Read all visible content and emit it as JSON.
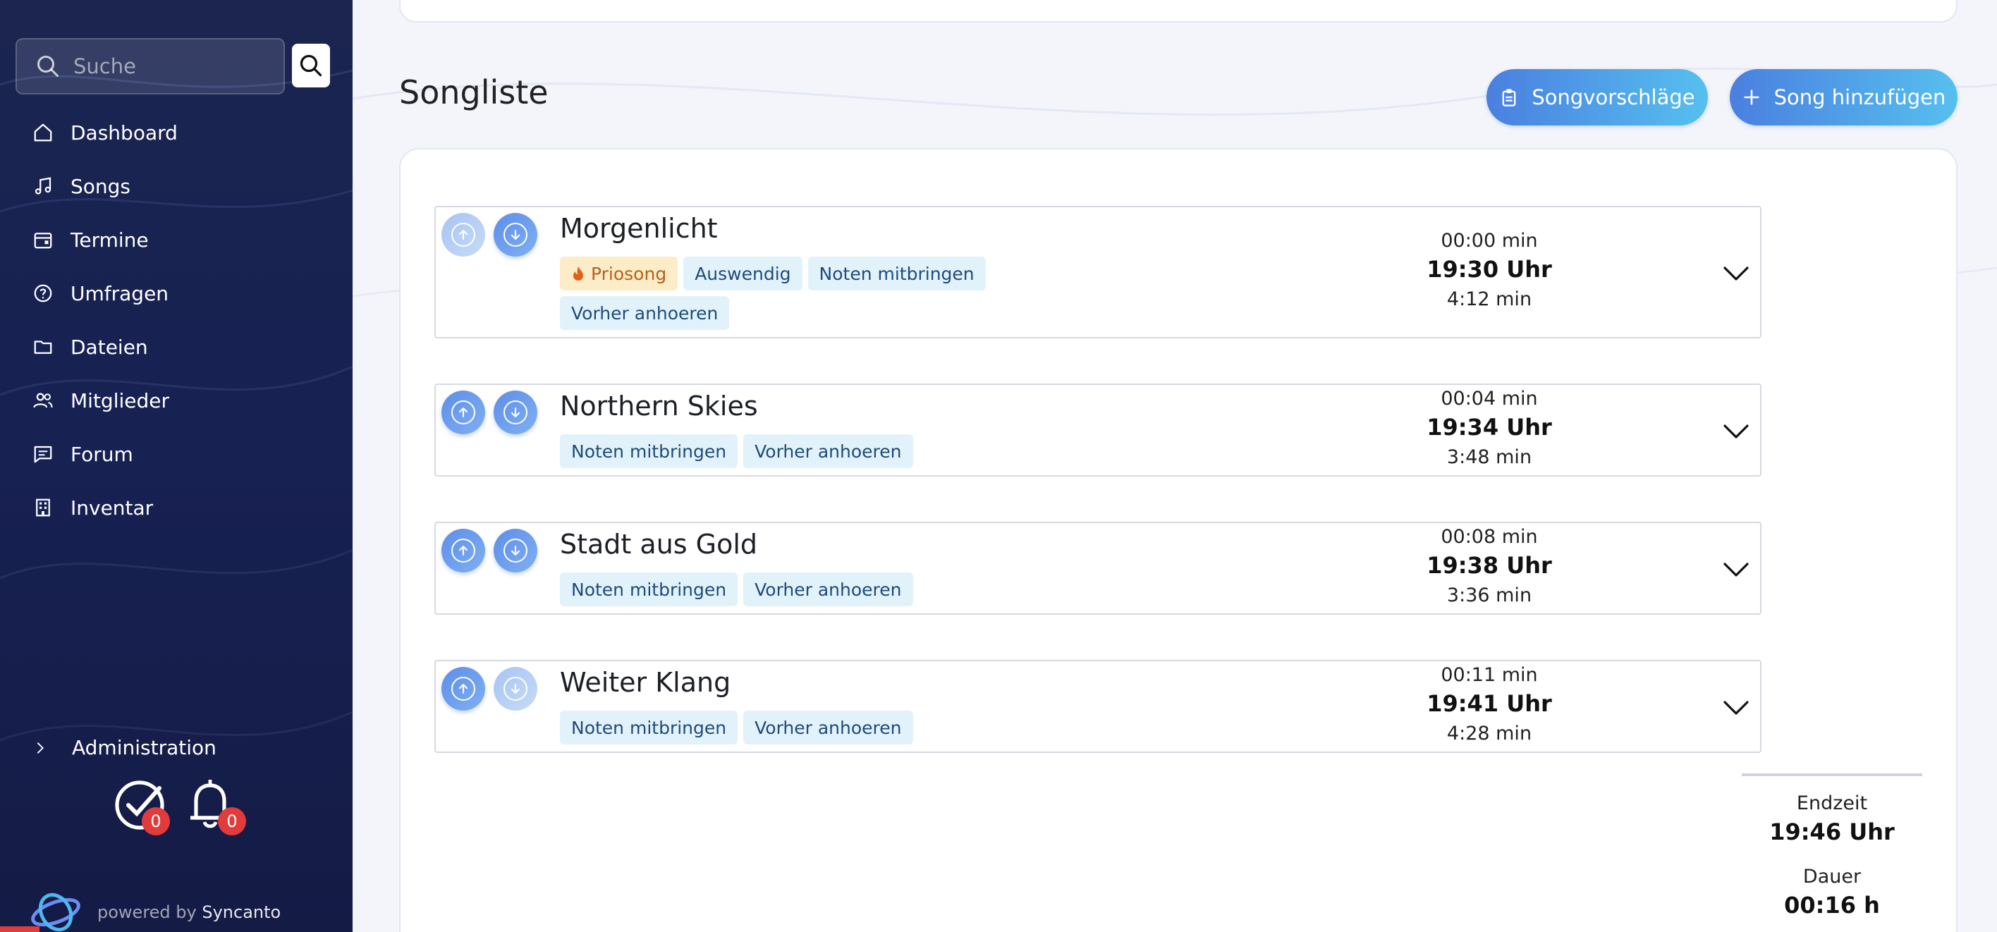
{
  "sidebar": {
    "search_placeholder": "Suche",
    "items": [
      {
        "label": "Dashboard",
        "icon": "home-icon"
      },
      {
        "label": "Songs",
        "icon": "music-note-icon"
      },
      {
        "label": "Termine",
        "icon": "calendar-icon"
      },
      {
        "label": "Umfragen",
        "icon": "question-circle-icon"
      },
      {
        "label": "Dateien",
        "icon": "folder-icon"
      },
      {
        "label": "Mitglieder",
        "icon": "users-icon"
      },
      {
        "label": "Forum",
        "icon": "chat-icon"
      },
      {
        "label": "Inventar",
        "icon": "building-icon"
      }
    ],
    "admin_label": "Administration",
    "tasks_count": "0",
    "notifications_count": "0",
    "powered_by_prefix": "powered by",
    "powered_by_brand": "Syncanto"
  },
  "main": {
    "title": "Songliste",
    "suggestions_button": "Songvorschläge",
    "add_button": "Song hinzufügen",
    "songs": [
      {
        "title": "Morgenlicht",
        "tags": [
          "Priosong",
          "Auswendig",
          "Noten mitbringen",
          "Vorher anhoeren"
        ],
        "offset": "00:00 min",
        "clock": "19:30 Uhr",
        "duration": "4:12 min"
      },
      {
        "title": "Northern Skies",
        "tags": [
          "Noten mitbringen",
          "Vorher anhoeren"
        ],
        "offset": "00:04 min",
        "clock": "19:34 Uhr",
        "duration": "3:48 min"
      },
      {
        "title": "Stadt aus Gold",
        "tags": [
          "Noten mitbringen",
          "Vorher anhoeren"
        ],
        "offset": "00:08 min",
        "clock": "19:38 Uhr",
        "duration": "3:36 min"
      },
      {
        "title": "Weiter Klang",
        "tags": [
          "Noten mitbringen",
          "Vorher anhoeren"
        ],
        "offset": "00:11 min",
        "clock": "19:41 Uhr",
        "duration": "4:28 min"
      }
    ],
    "summary": {
      "end_label": "Endzeit",
      "end_value": "19:46 Uhr",
      "duration_label": "Dauer",
      "duration_value": "00:16 h"
    }
  },
  "colors": {
    "sidebar_bg": "#1b2550",
    "accent_start": "#4a7fe0",
    "accent_end": "#56c0ee",
    "tag_bg": "#e2f2fb",
    "prio_bg": "#fdecc8",
    "badge_red": "#e23b3b"
  }
}
